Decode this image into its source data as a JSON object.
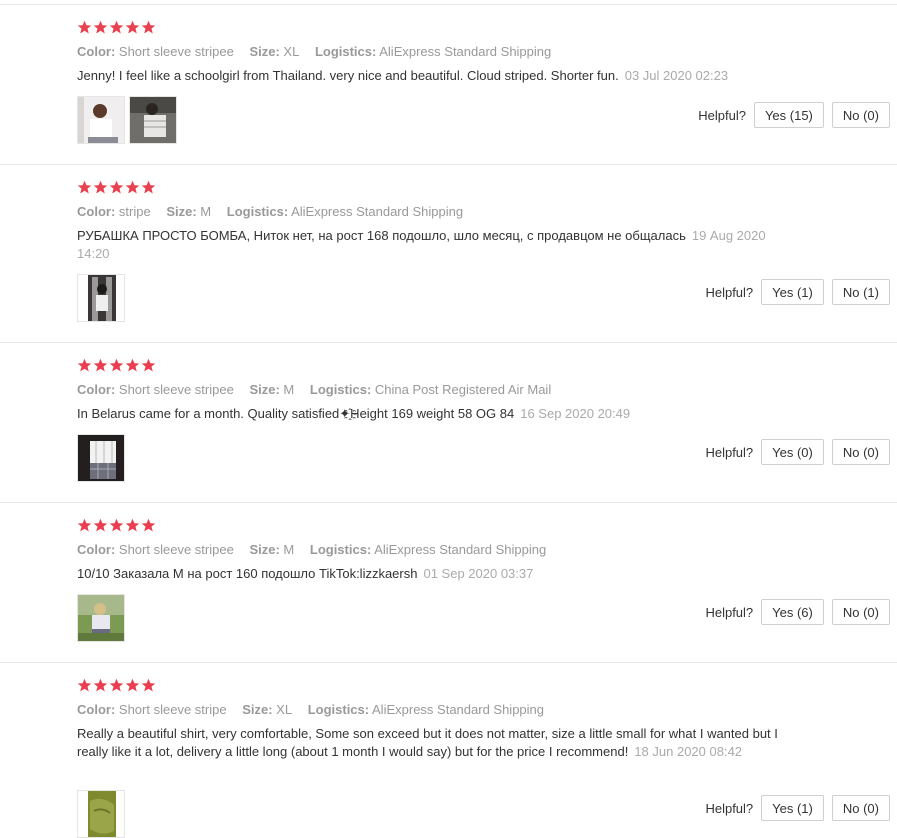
{
  "colors": {
    "star": "#e62e04",
    "meta": "#999999",
    "text": "#333333"
  },
  "labels": {
    "color": "Color:",
    "size": "Size:",
    "logistics": "Logistics:",
    "helpful": "Helpful?"
  },
  "reviews": [
    {
      "rating": 5,
      "color": "Short sleeve stripee",
      "size": "XL",
      "logistics": "AliExpress Standard Shipping",
      "text": "Jenny! I feel like a schoolgirl from Thailand. very nice and beautiful. Cloud striped. Shorter fun.",
      "date": "03 Jul 2020 02:23",
      "yes": "Yes (15)",
      "no": "No (0)"
    },
    {
      "rating": 5,
      "color": "stripe",
      "size": "M",
      "logistics": "AliExpress Standard Shipping",
      "text": "РУБАШКА ПРОСТО БОМБА, Ниток нет, на рост 168 подошло, шло месяц, с продавцом не общалась",
      "date": "19 Aug 2020 14:20",
      "yes": "Yes (1)",
      "no": "No (1)"
    },
    {
      "rating": 5,
      "color": "Short sleeve stripee",
      "size": "M",
      "logistics": "China Post Registered Air Mail",
      "text": "In Belarus came for a month. Quality satisfied✦҈Height 169 weight 58 OG 84",
      "date": "16 Sep 2020 20:49",
      "yes": "Yes (0)",
      "no": "No (0)"
    },
    {
      "rating": 5,
      "color": "Short sleeve stripee",
      "size": "M",
      "logistics": "AliExpress Standard Shipping",
      "text": "10/10 Заказала М на рост 160 подошло TikTok:lizzkaersh",
      "date": "01 Sep 2020 03:37",
      "yes": "Yes (6)",
      "no": "No (0)"
    },
    {
      "rating": 5,
      "color": "Short sleeve stripe",
      "size": "XL",
      "logistics": "AliExpress Standard Shipping",
      "text": "Really a beautiful shirt, very comfortable, Some son exceed but it does not matter, size a little small for what I wanted but I really like it a lot, delivery a little long (about 1 month I would say) but for the price I recommend!",
      "date": "18 Jun 2020 08:42",
      "yes": "Yes (1)",
      "no": "No (0)"
    }
  ]
}
